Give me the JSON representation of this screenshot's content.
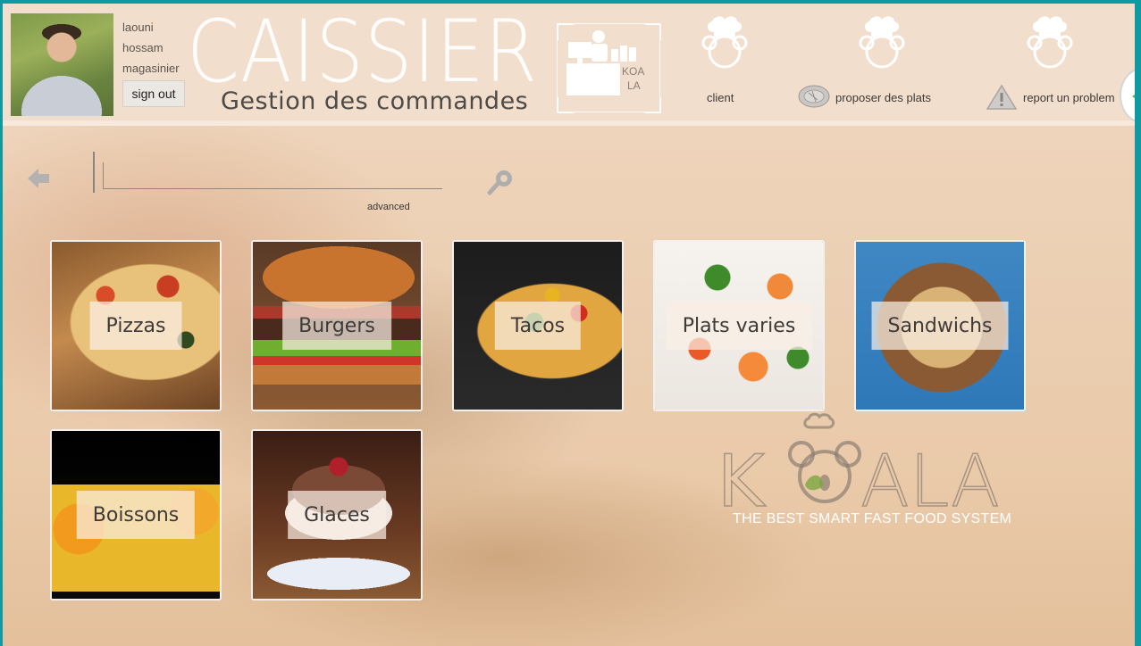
{
  "user": {
    "first_name": "laouni",
    "last_name": "hossam",
    "role": "magasinier",
    "signout_label": "sign out"
  },
  "brand": {
    "title": "CAISSIER",
    "subtitle": "Gestion des commandes",
    "logo_line1": "KOA",
    "logo_line2": "LA"
  },
  "nav": {
    "client": "client",
    "propose": "proposer des plats",
    "report": "report un problem"
  },
  "search": {
    "value": "",
    "placeholder": "",
    "advanced_label": "advanced"
  },
  "categories": [
    {
      "label": "Pizzas"
    },
    {
      "label": "Burgers"
    },
    {
      "label": "Tacos"
    },
    {
      "label": "Plats varies"
    },
    {
      "label": "Sandwichs"
    },
    {
      "label": "Boissons"
    },
    {
      "label": "Glaces"
    }
  ],
  "watermark": {
    "name": "KOALA",
    "tagline": "THE BEST SMART FAST FOOD SYSTEM"
  },
  "colors": {
    "window_border": "#0e9aa0",
    "header_bg": "#f2decd",
    "accent_green": "#3cc24a"
  }
}
